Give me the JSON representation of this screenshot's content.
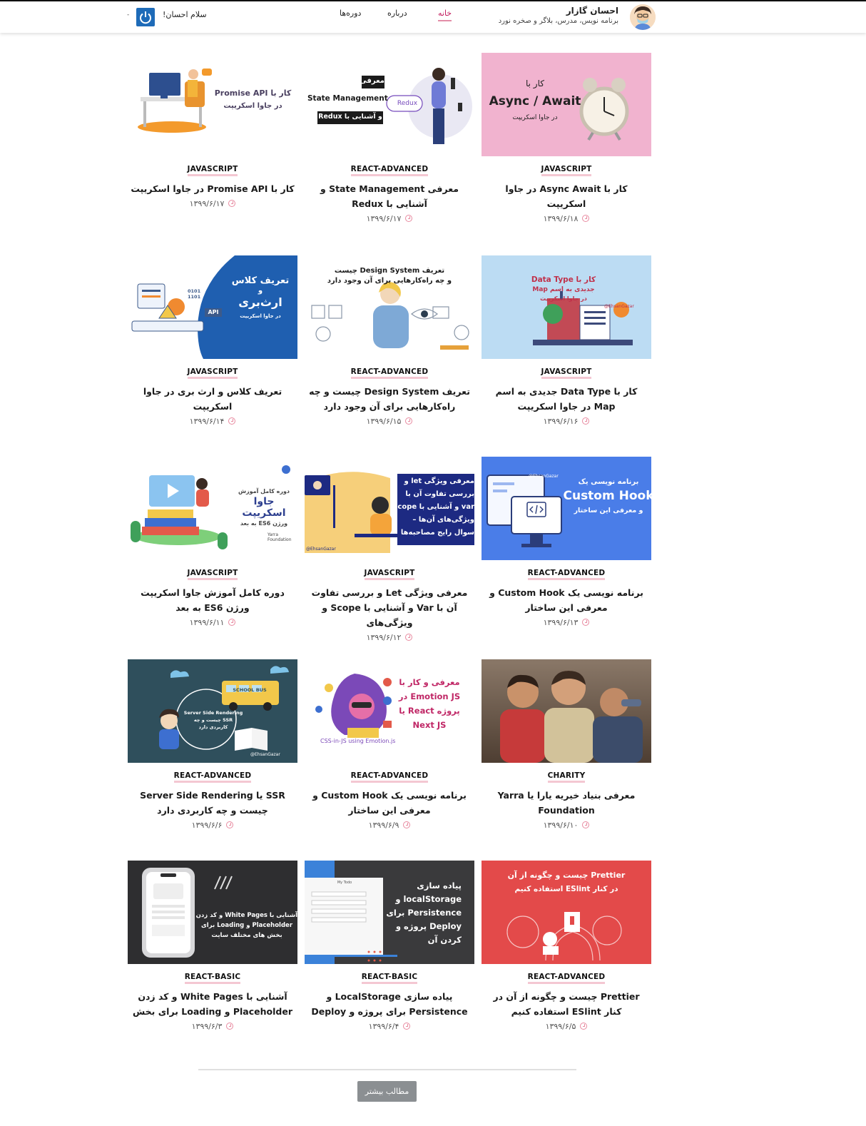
{
  "header": {
    "brand_name": "احسان گازار",
    "brand_sub": "برنامه نویس، مدرس، بلاگر و صخره نورد",
    "nav": {
      "home": "خانه",
      "about": "درباره",
      "courses": "دوره‌ها"
    },
    "greeting": "سلام احسان!",
    "caret": "-"
  },
  "posts": [
    {
      "category": "JAVASCRIPT",
      "title": "کار با Async Await در جاوا اسکریپت",
      "date": "۱۳۹۹/۶/۱۸",
      "thumb": {
        "bg": "#f1b3cf",
        "line1": "کار با",
        "line2": "Async / Await",
        "line3": "در جاوا اسکریپت",
        "icon": "alarm-clock"
      }
    },
    {
      "category": "REACT-ADVANCED",
      "title": "معرفی State Management و آشنایی با Redux",
      "date": "۱۳۹۹/۶/۱۷",
      "thumb": {
        "bg": "#ffffff",
        "line1": "معرفی",
        "line2": "State Management",
        "line3": "و آشنایی با Redux",
        "badge": "Redux"
      }
    },
    {
      "category": "JAVASCRIPT",
      "title": "کار با Promise API در جاوا اسکریپت",
      "date": "۱۳۹۹/۶/۱۷",
      "thumb": {
        "bg": "#ffffff",
        "line1": "کار با Promise API",
        "line2": "در جاوا اسکریپت"
      }
    },
    {
      "category": "JAVASCRIPT",
      "title": "کار با Data Type جدیدی به اسم Map در جاوا اسکریپت",
      "date": "۱۳۹۹/۶/۱۶",
      "thumb": {
        "bg": "#bcdcf3",
        "line1": "کار با Data Type",
        "line2": "جدیدی به اسم Map",
        "line3": "در جاوا اسکریپت",
        "handle": "@EhsanGazar"
      }
    },
    {
      "category": "REACT-ADVANCED",
      "title": "تعریف Design System چیست و چه راه‌کارهایی برای آن وجود دارد",
      "date": "۱۳۹۹/۶/۱۵",
      "thumb": {
        "bg": "#ffffff",
        "line1": "تعریف Design System چیست",
        "line2": "و چه راه‌کارهایی برای آن وجود دارد"
      }
    },
    {
      "category": "JAVASCRIPT",
      "title": "تعریف کلاس و ارث بری در جاوا اسکریپت",
      "date": "۱۳۹۹/۶/۱۴",
      "thumb": {
        "bg": "#ffffff",
        "line1": "تعریف کلاس",
        "line2": "و",
        "line3": "ارث‌بری",
        "line4": "در جاوا اسکریپت",
        "code": "0101 1101",
        "api": "API"
      }
    },
    {
      "category": "REACT-ADVANCED",
      "title": "برنامه نویسی یک Custom Hook و معرفی این ساختار",
      "date": "۱۳۹۹/۶/۱۳",
      "thumb": {
        "bg": "#4a7de8",
        "line1": "برنامه نویسی یک",
        "line2": "Custom Hook",
        "line3": "و معرفی این ساختار",
        "handle": "@EhsanGazar"
      }
    },
    {
      "category": "JAVASCRIPT",
      "title": "معرفی ویژگی Let و بررسی تفاوت آن با Var و آشنایی با Scope و ویژگی‌های",
      "date": "۱۳۹۹/۶/۱۲",
      "thumb": {
        "bg": "#ffffff",
        "line1": "معرفی ویژگی let و",
        "line2": "بررسی تفاوت آن با",
        "line3": "var و آشنایی با scope",
        "line4": "ویژگی‌های آن‌ها –",
        "line5": "سوال رایج مصاحبه‌ها",
        "handle": "@EhsanGazar"
      }
    },
    {
      "category": "JAVASCRIPT",
      "title": "دوره کامل آموزش جاوا اسکریپت ورژن ES6 به بعد",
      "date": "۱۳۹۹/۶/۱۱",
      "thumb": {
        "bg": "#ffffff",
        "line1": "دوره کامل آموزش",
        "line2": "جاوا اسکریپت",
        "line3": "ورژن ES6 به بعد",
        "org": "Yarra Foundation"
      }
    },
    {
      "category": "CHARITY",
      "title": "معرفی بنیاد خیریه یارا یا Yarra Foundation",
      "date": "۱۳۹۹/۶/۱۰",
      "thumb": {
        "bg": "#6e5a4c"
      }
    },
    {
      "category": "REACT-ADVANCED",
      "title": "برنامه نویسی یک Custom Hook و معرفی این ساختار",
      "date": "۱۳۹۹/۶/۹",
      "thumb": {
        "bg": "#ffffff",
        "line1": "معرفی و کار با",
        "line2": "Emotion JS در",
        "line3": "پروژه React یا",
        "line4": "Next JS",
        "caption": "CSS-in-JS using Emotion.js"
      }
    },
    {
      "category": "REACT-ADVANCED",
      "title": "SSR یا Server Side Rendering چیست و چه کاربردی دارد",
      "date": "۱۳۹۹/۶/۶",
      "thumb": {
        "bg": "#2f4f5c",
        "line1": "Server Side Rendering",
        "line2": "SSR چیست و چه",
        "line3": "کاربردی دارد",
        "bus": "SCHOOL BUS",
        "handle": "@EhsanGazar"
      }
    },
    {
      "category": "REACT-ADVANCED",
      "title": "Prettier چیست و چگونه از آن در کنار ESlint استفاده کنیم",
      "date": "۱۳۹۹/۶/۵",
      "thumb": {
        "bg": "#e34a4a",
        "line1": "Prettier چیست و چگونه از آن",
        "line2": "در کنار ESlint استفاده کنیم"
      }
    },
    {
      "category": "REACT-BASIC",
      "title": "پیاده سازی LocalStorage و Persistence برای پروژه و Deploy",
      "date": "۱۳۹۹/۶/۴",
      "thumb": {
        "bg": "#3a3a3c",
        "line1": "پیاده سازی",
        "line2": "localStorage و",
        "line3": "Persistence برای",
        "line4": "Deploy پروژه و",
        "line5": "کردن آن",
        "app": "My Todo"
      }
    },
    {
      "category": "REACT-BASIC",
      "title": "آشنایی با White Pages و کد زدن Placeholder و Loading برای بخش",
      "date": "۱۳۹۹/۶/۳",
      "thumb": {
        "bg": "#2e2e30",
        "line1": "آشنایی با White Pages و کد زدن",
        "line2": "Placeholder و Loading برای",
        "line3": "بخش های مختلف سایت"
      }
    }
  ],
  "more_button": "مطالب بیشتر"
}
